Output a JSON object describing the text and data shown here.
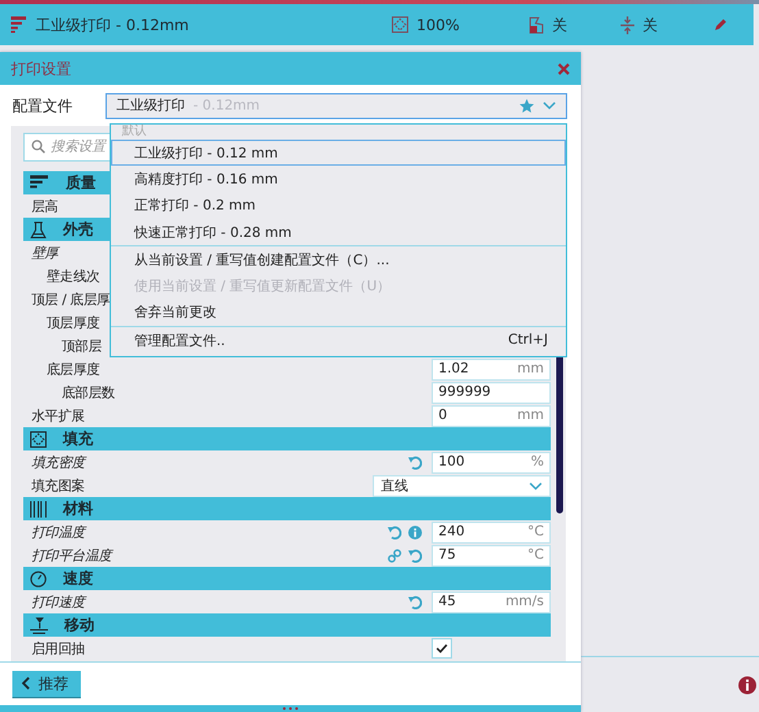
{
  "topbar": {
    "profile": "工业级打印 - 0.12mm",
    "infill": "100%",
    "support": "关",
    "adhesion": "关"
  },
  "dialog": {
    "title": "打印设置",
    "profile_label": "配置文件",
    "profile_name": "工业级打印",
    "profile_suffix": " - 0.12mm",
    "search_placeholder": "搜索设置",
    "menu": {
      "header": "默认",
      "profiles": [
        {
          "label": "工业级打印 - 0.12 mm",
          "selected": true
        },
        {
          "label": "高精度打印 - 0.16 mm",
          "selected": false
        },
        {
          "label": "正常打印 - 0.2 mm",
          "selected": false
        },
        {
          "label": "快速正常打印 - 0.28 mm",
          "selected": false
        }
      ],
      "actions": [
        {
          "label": "从当前设置 / 重写值创建配置文件（C）...",
          "disabled": false
        },
        {
          "label": "使用当前设置 / 重写值更新配置文件（U）",
          "disabled": true
        },
        {
          "label": "舍弃当前更改",
          "disabled": false
        }
      ],
      "manage": {
        "label": "管理配置文件..",
        "shortcut": "Ctrl+J"
      }
    },
    "settings": [
      {
        "kind": "section",
        "label": "质量",
        "children": [
          {
            "kind": "group",
            "label": "层高",
            "modified": false
          }
        ]
      },
      {
        "kind": "section",
        "label": "外壳",
        "children": [
          {
            "kind": "group",
            "label": "壁厚",
            "modified": true,
            "children": [
              {
                "kind": "group",
                "label": "壁走线次",
                "modified": false
              }
            ]
          },
          {
            "kind": "group",
            "label": "顶层 / 底层厚",
            "modified": false,
            "children": [
              {
                "kind": "group",
                "label": "顶层厚度",
                "modified": false,
                "children": [
                  {
                    "kind": "group",
                    "label": "顶部层",
                    "modified": false
                  }
                ]
              },
              {
                "kind": "number",
                "label": "底层厚度",
                "modified": false,
                "value": "1.02",
                "unit": "mm",
                "children": [
                  {
                    "kind": "number",
                    "label": "底部层数",
                    "modified": false,
                    "value": "999999"
                  }
                ]
              }
            ]
          },
          {
            "kind": "number",
            "label": "水平扩展",
            "modified": false,
            "value": "0",
            "unit": "mm"
          }
        ]
      },
      {
        "kind": "section",
        "label": "填充",
        "children": [
          {
            "kind": "number",
            "label": "填充密度",
            "modified": true,
            "reset": true,
            "value": "100",
            "unit": "%"
          },
          {
            "kind": "select",
            "label": "填充图案",
            "modified": false,
            "value": "直线"
          }
        ]
      },
      {
        "kind": "section",
        "label": "材料",
        "children": [
          {
            "kind": "number",
            "label": "打印温度",
            "modified": true,
            "reset": true,
            "info": true,
            "value": "240",
            "unit": "°C"
          },
          {
            "kind": "number",
            "label": "打印平台温度",
            "modified": true,
            "link": true,
            "reset": true,
            "value": "75",
            "unit": "°C"
          }
        ]
      },
      {
        "kind": "section",
        "label": "速度",
        "children": [
          {
            "kind": "number",
            "label": "打印速度",
            "modified": true,
            "reset": true,
            "value": "45",
            "unit": "mm/s"
          }
        ]
      },
      {
        "kind": "section",
        "label": "移动",
        "children": [
          {
            "kind": "checkbox",
            "label": "启用回抽",
            "modified": false,
            "checked": true
          }
        ]
      }
    ],
    "recommend_button": "推荐"
  }
}
